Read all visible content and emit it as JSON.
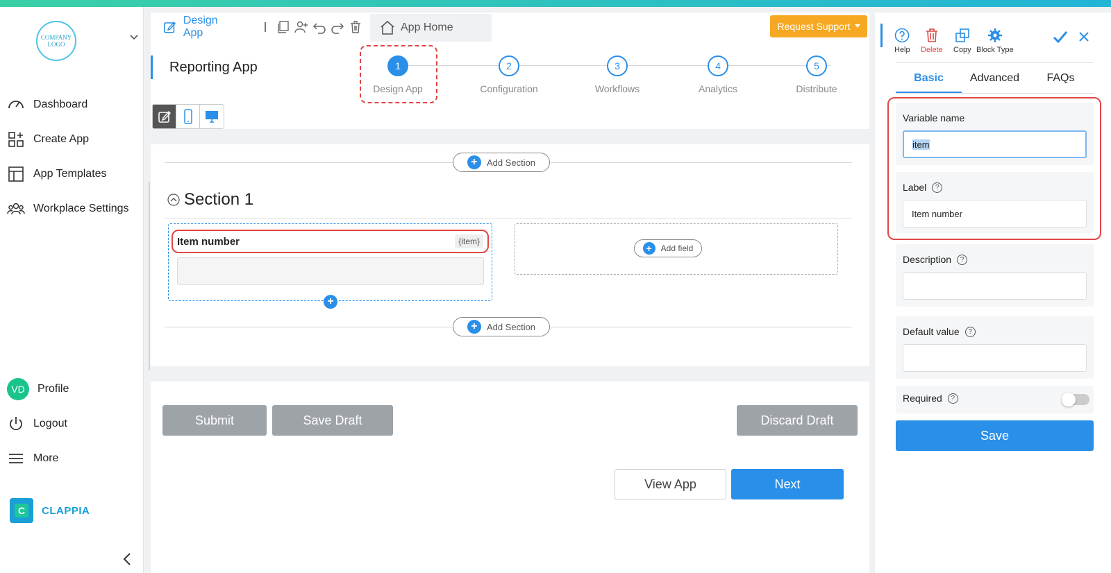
{
  "sidebar": {
    "logo_text": "COMPANY LOGO",
    "nav": [
      {
        "label": "Dashboard",
        "icon": "gauge-icon"
      },
      {
        "label": "Create App",
        "icon": "grid-plus-icon"
      },
      {
        "label": "App Templates",
        "icon": "template-icon"
      },
      {
        "label": "Workplace Settings",
        "icon": "users-icon"
      }
    ],
    "profile": {
      "initials": "VD",
      "label": "Profile"
    },
    "logout_label": "Logout",
    "more_label": "More",
    "brand_name": "CLAPPIA"
  },
  "header": {
    "design_tab_label": "Design App",
    "home_tab_label": "App Home",
    "support_button": "Request Support",
    "app_title": "Reporting App"
  },
  "steps": [
    {
      "num": "1",
      "label": "Design App",
      "active": true
    },
    {
      "num": "2",
      "label": "Configuration",
      "active": false
    },
    {
      "num": "3",
      "label": "Workflows",
      "active": false
    },
    {
      "num": "4",
      "label": "Analytics",
      "active": false
    },
    {
      "num": "5",
      "label": "Distribute",
      "active": false
    }
  ],
  "canvas": {
    "add_section_label": "Add Section",
    "section_title": "Section 1",
    "field": {
      "label": "Item number",
      "variable_chip": "{item}",
      "value": ""
    },
    "add_field_label": "Add field"
  },
  "actions": {
    "submit": "Submit",
    "save_draft": "Save Draft",
    "discard_draft": "Discard Draft",
    "view_app": "View App",
    "next": "Next"
  },
  "panel": {
    "tools": [
      {
        "label": "Help",
        "icon": "help-icon"
      },
      {
        "label": "Delete",
        "icon": "trash-icon"
      },
      {
        "label": "Copy",
        "icon": "copy-icon"
      },
      {
        "label": "Block Type",
        "icon": "gear-icon"
      }
    ],
    "tabs": [
      "Basic",
      "Advanced",
      "FAQs"
    ],
    "variable_name": {
      "label": "Variable name",
      "value": "item"
    },
    "label_field": {
      "label": "Label",
      "value": "Item number"
    },
    "description": {
      "label": "Description",
      "value": ""
    },
    "default_value": {
      "label": "Default value",
      "value": ""
    },
    "required": {
      "label": "Required",
      "on": false
    },
    "save_button": "Save"
  },
  "colors": {
    "primary": "#2a8fe8",
    "warning": "#f7a823",
    "highlight": "#e04646",
    "neutral_button": "#9ea3a8"
  }
}
